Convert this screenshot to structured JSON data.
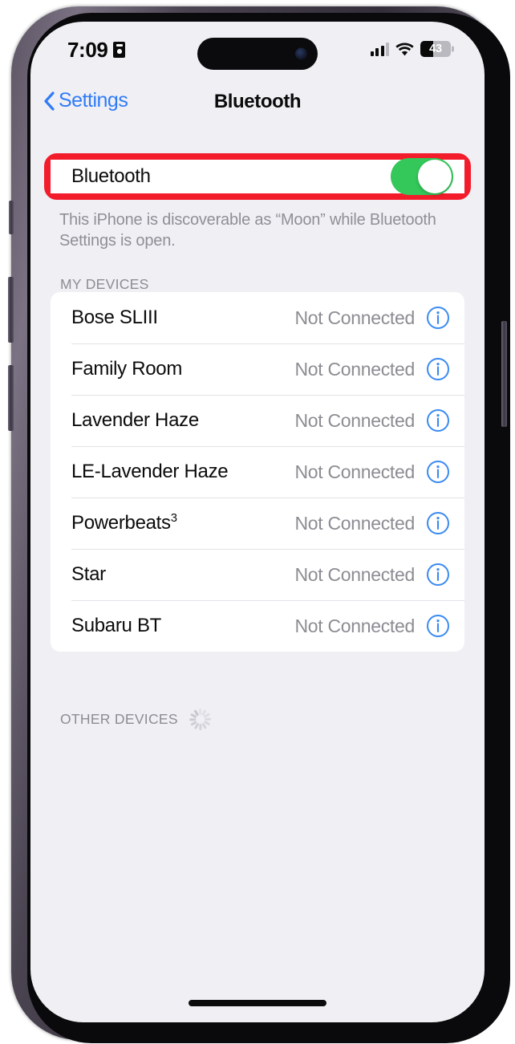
{
  "status_bar": {
    "time": "7:09",
    "time_icon": "id-card-icon",
    "cellular_icon": "cellular-signal-icon",
    "cellular_bars_filled": 3,
    "cellular_bars_total": 4,
    "wifi_icon": "wifi-icon",
    "battery_icon": "battery-icon",
    "battery_level": "43",
    "battery_percent": 43
  },
  "nav_bar": {
    "back_icon": "chevron-left-icon",
    "back_label": "Settings",
    "title": "Bluetooth"
  },
  "bluetooth_setting": {
    "label": "Bluetooth",
    "toggle_state": "on",
    "toggle_color": "#34c759",
    "highlight_color": "#f31c2b",
    "footnote": "This iPhone is discoverable as “Moon” while Bluetooth Settings is open."
  },
  "my_devices": {
    "header": "MY DEVICES",
    "devices": [
      {
        "name": "Bose SLIII",
        "status": "Not Connected",
        "info_icon": "info-circle-icon"
      },
      {
        "name": "Family Room",
        "status": "Not Connected",
        "info_icon": "info-circle-icon"
      },
      {
        "name": "Lavender Haze",
        "status": "Not Connected",
        "info_icon": "info-circle-icon"
      },
      {
        "name": "LE-Lavender Haze",
        "status": "Not Connected",
        "info_icon": "info-circle-icon"
      },
      {
        "name": "Powerbeats",
        "name_superscript": "3",
        "status": "Not Connected",
        "info_icon": "info-circle-icon"
      },
      {
        "name": "Star",
        "status": "Not Connected",
        "info_icon": "info-circle-icon"
      },
      {
        "name": "Subaru BT",
        "status": "Not Connected",
        "info_icon": "info-circle-icon"
      }
    ]
  },
  "other_devices": {
    "header": "OTHER DEVICES",
    "spinner_icon": "activity-spinner-icon"
  },
  "colors": {
    "accent_blue": "#2f7cf6",
    "toggle_green": "#34c759",
    "highlight_red": "#f31c2b",
    "secondary_text": "#8d8c93",
    "screen_background": "#f0eff4"
  }
}
